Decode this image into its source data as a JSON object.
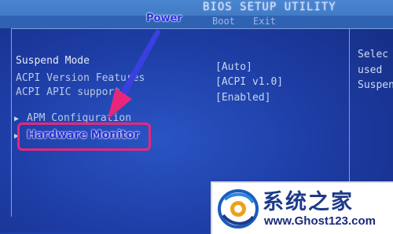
{
  "header": {
    "title": "BIOS SETUP UTILITY",
    "tabs": [
      "Boot",
      "Exit"
    ]
  },
  "menu": {
    "items": [
      {
        "label": "Suspend Mode",
        "value": "[Auto]"
      },
      {
        "label": "ACPI Version Features",
        "value": "[ACPI v1.0]"
      },
      {
        "label": "ACPI APIC support",
        "value": "[Enabled]"
      }
    ],
    "submenus": [
      "APM Configuration",
      "Hardware Monitor"
    ]
  },
  "help_panel": {
    "lines": [
      "Selec",
      "used",
      "Suspen"
    ]
  },
  "annotations": {
    "callout": "Power",
    "highlight_color": "#e8277a",
    "arrow_color": "#3a3fe0"
  },
  "watermark": {
    "title": "系统之家",
    "url": "www.Ghost123.com"
  }
}
